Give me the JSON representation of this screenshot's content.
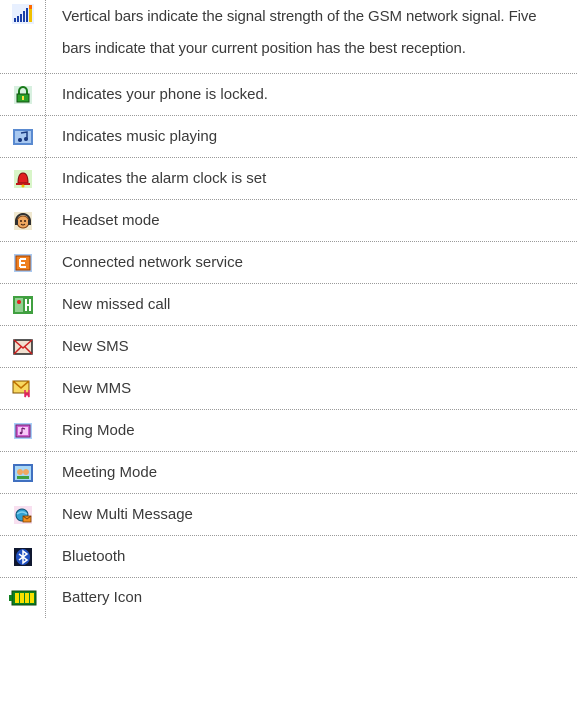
{
  "rows": [
    {
      "icon": "signal-bars-icon",
      "text": "Vertical bars indicate the signal strength of the GSM network signal. Five bars indicate that your current position has the best reception."
    },
    {
      "icon": "lock-icon",
      "text": "Indicates your phone is locked."
    },
    {
      "icon": "music-icon",
      "text": "Indicates music playing"
    },
    {
      "icon": "alarm-bell-icon",
      "text": "Indicates the alarm clock is set"
    },
    {
      "icon": "headset-icon",
      "text": "Headset mode"
    },
    {
      "icon": "network-service-icon",
      "text": "Connected network service"
    },
    {
      "icon": "missed-call-icon",
      "text": "New missed call"
    },
    {
      "icon": "sms-envelope-icon",
      "text": "New SMS"
    },
    {
      "icon": "mms-envelope-icon",
      "text": "New MMS"
    },
    {
      "icon": "ring-mode-icon",
      "text": "Ring Mode"
    },
    {
      "icon": "meeting-mode-icon",
      "text": "Meeting Mode"
    },
    {
      "icon": "multi-message-icon",
      "text": "New Multi Message"
    },
    {
      "icon": "bluetooth-icon",
      "text": "Bluetooth"
    },
    {
      "icon": "battery-icon",
      "text": "Battery Icon"
    }
  ]
}
